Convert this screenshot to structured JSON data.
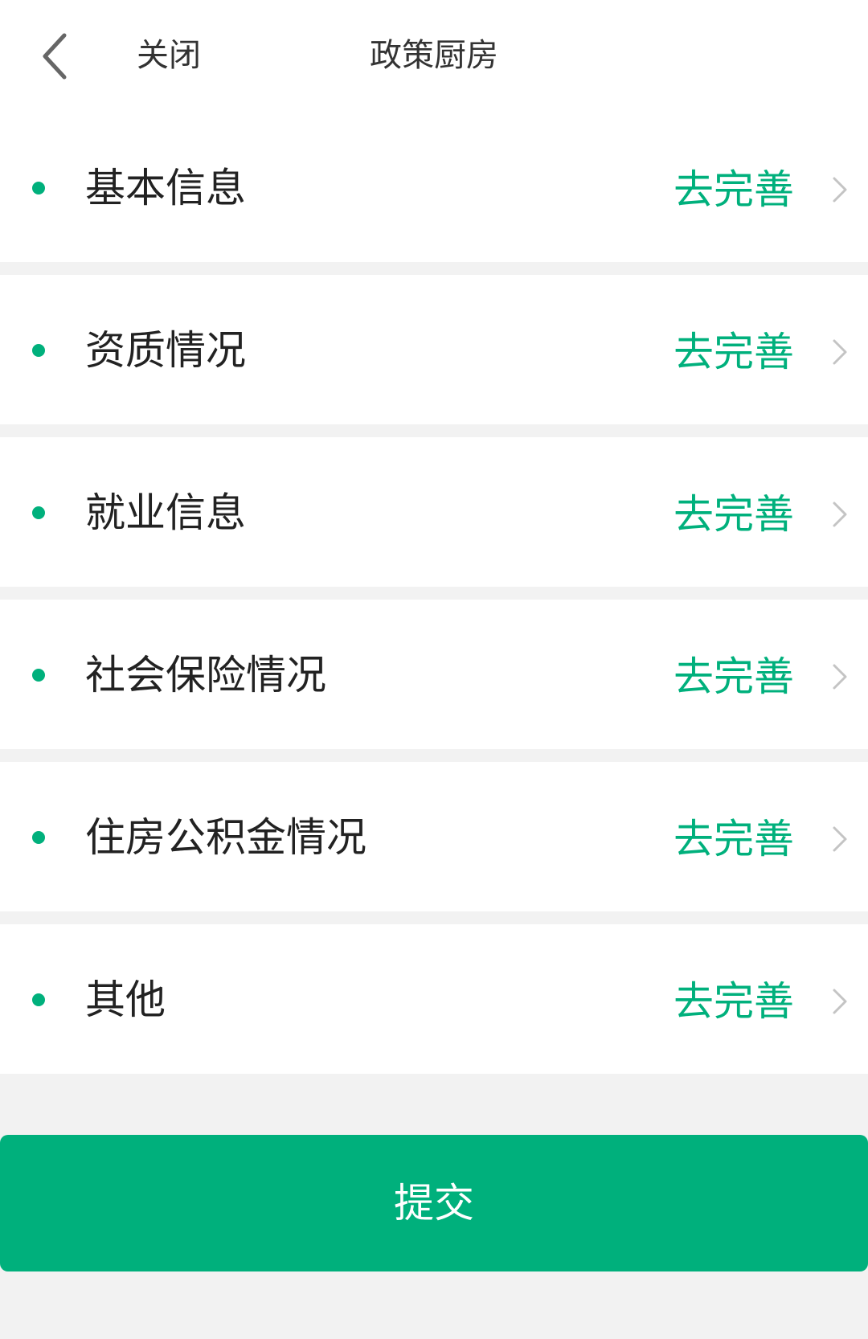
{
  "header": {
    "back_icon": "chevron-left-icon",
    "close_label": "关闭",
    "title": "政策厨房"
  },
  "colors": {
    "accent": "#00b07c",
    "chevron": "#c4c4c4",
    "text": "#222222",
    "background": "#f2f2f2"
  },
  "sections": [
    {
      "label": "基本信息",
      "action": "去完善"
    },
    {
      "label": "资质情况",
      "action": "去完善"
    },
    {
      "label": "就业信息",
      "action": "去完善"
    },
    {
      "label": "社会保险情况",
      "action": "去完善"
    },
    {
      "label": "住房公积金情况",
      "action": "去完善"
    },
    {
      "label": "其他",
      "action": "去完善"
    }
  ],
  "submit_label": "提交"
}
